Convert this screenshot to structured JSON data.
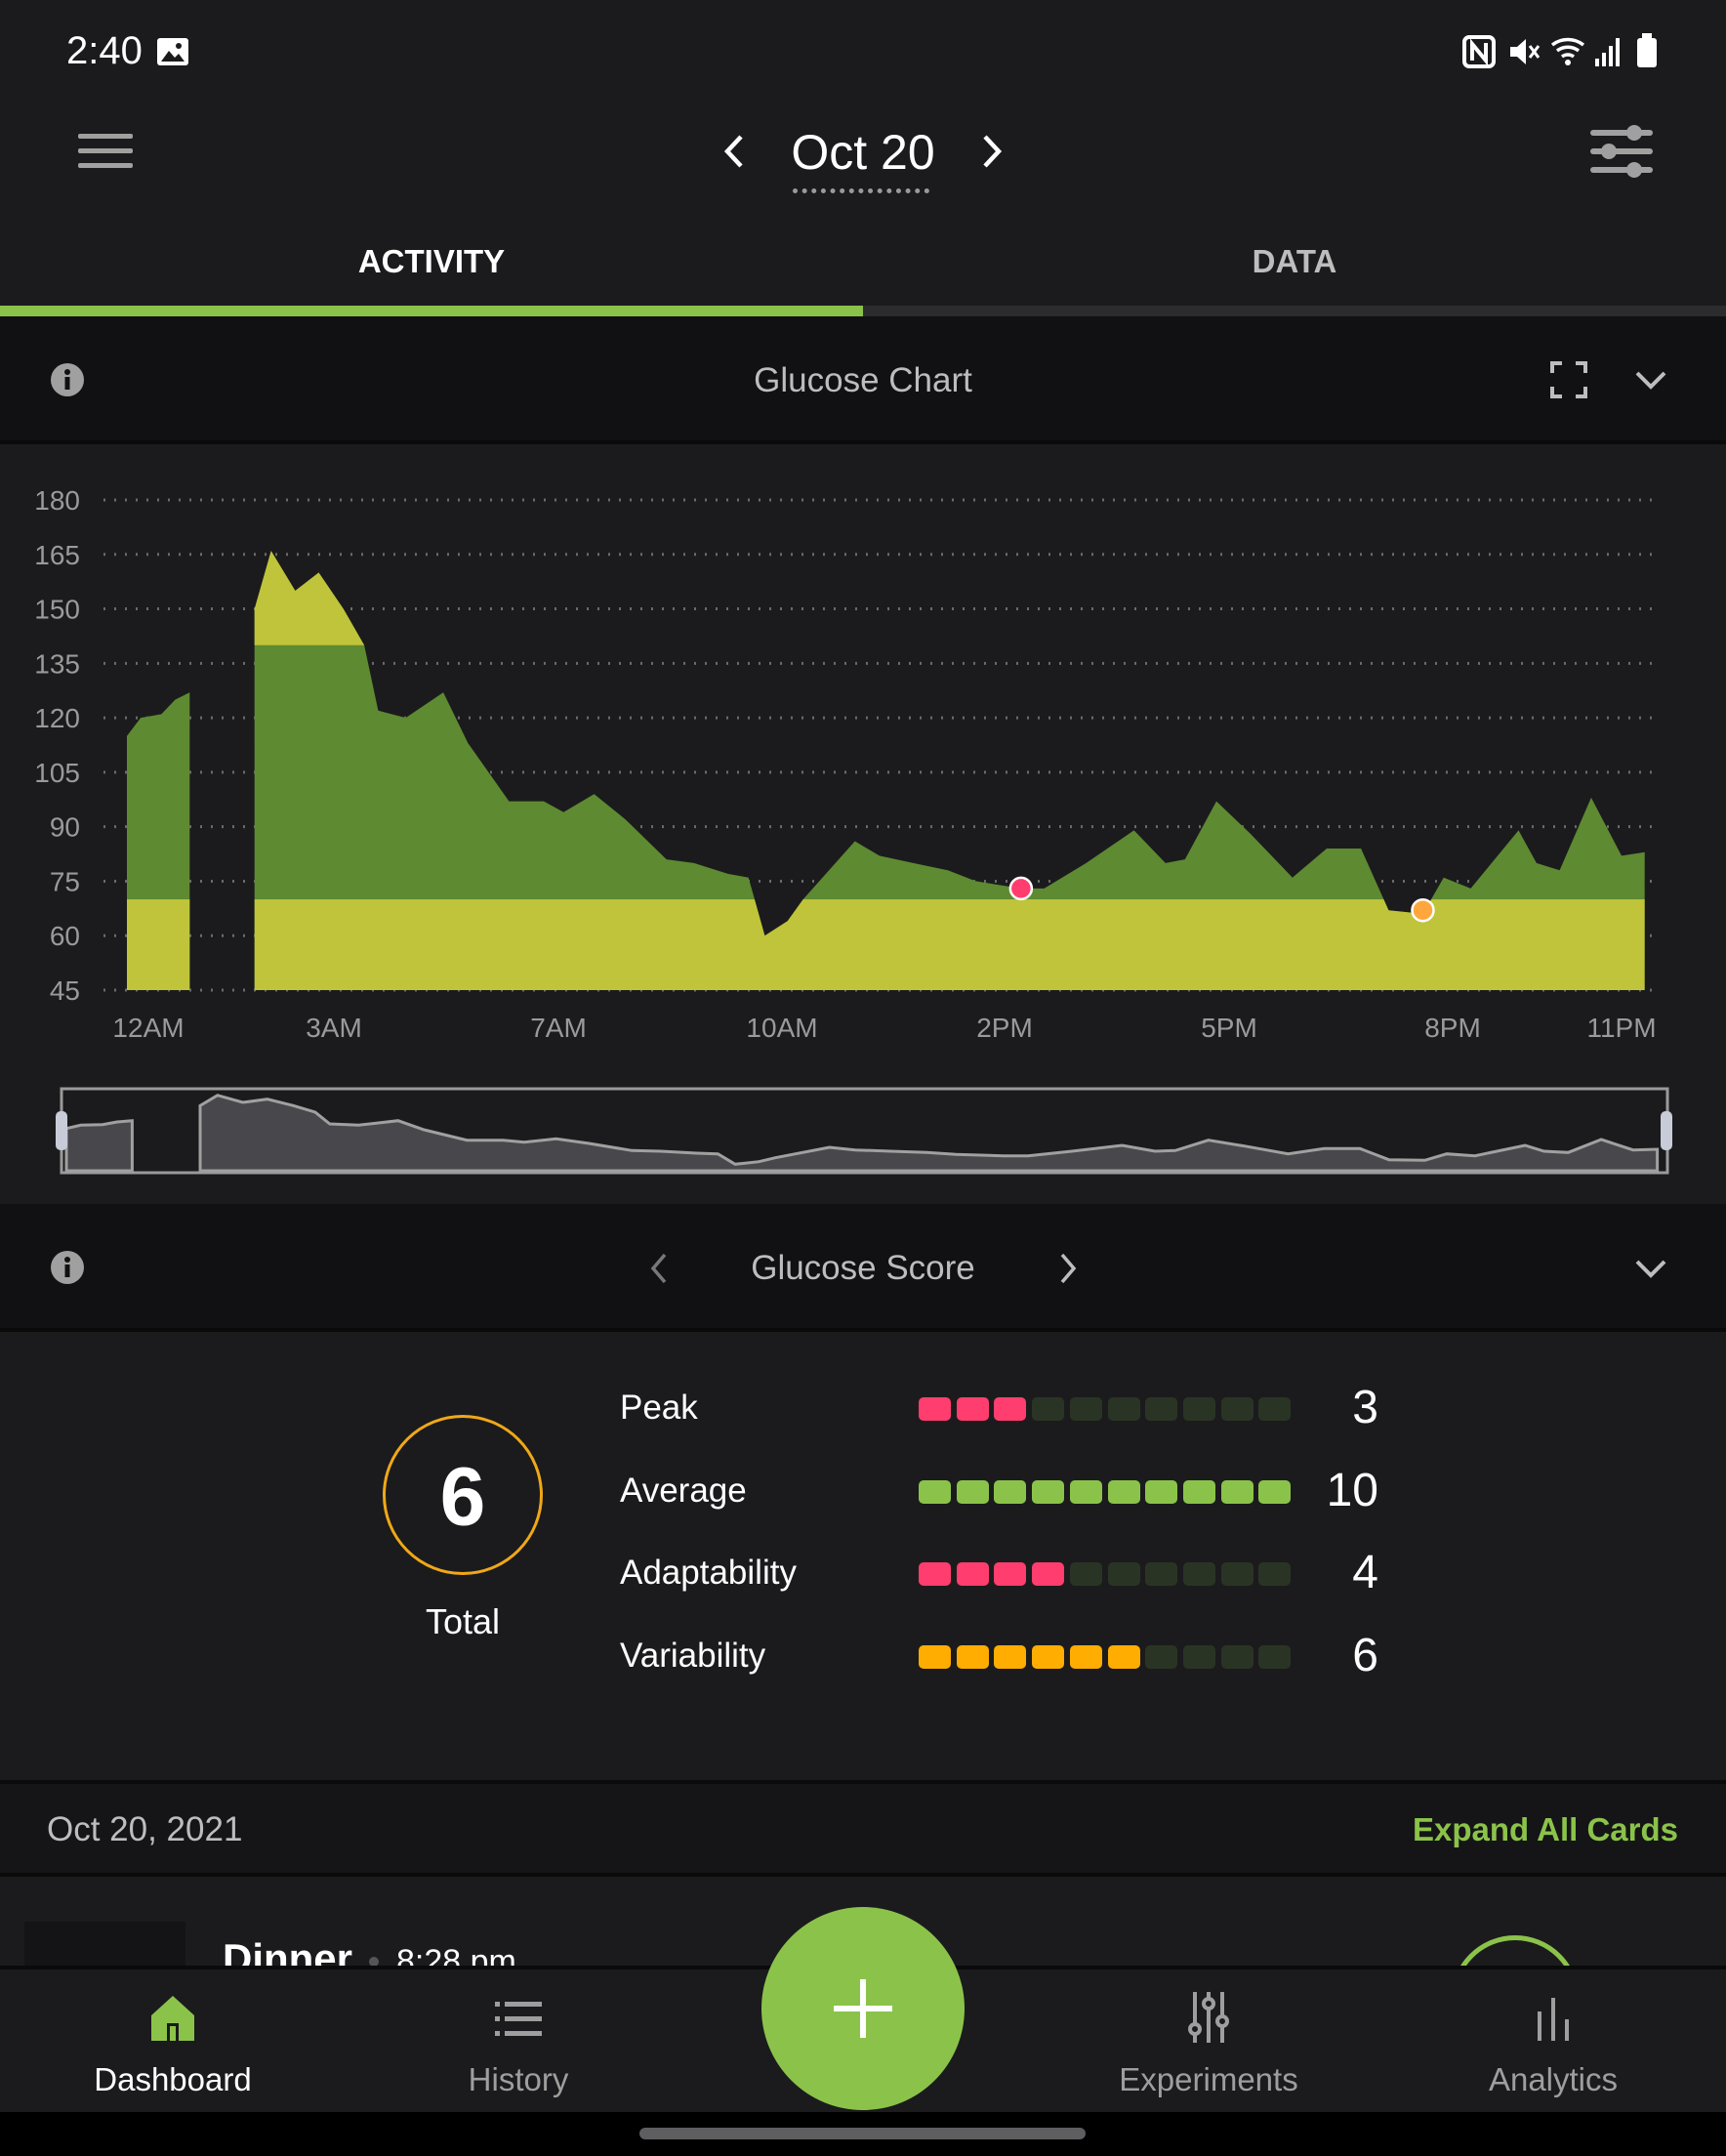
{
  "status_bar": {
    "time": "2:40",
    "icons": [
      "image-icon",
      "nfc-icon",
      "mute-icon",
      "wifi-icon",
      "signal-icon",
      "battery-icon"
    ]
  },
  "header": {
    "date": "Oct 20",
    "menu_icon": "hamburger-icon",
    "filter_icon": "sliders-icon"
  },
  "tabs": [
    {
      "label": "ACTIVITY",
      "active": true
    },
    {
      "label": "DATA",
      "active": false
    }
  ],
  "colors": {
    "accent": "#8bc34a",
    "in_range": "#5e8a31",
    "out_range": "#bfc43a",
    "peak": "#ff3d6e",
    "average": "#8bc34a",
    "variability": "#ffad00",
    "empty": "#2a3424",
    "ring": "#f0a818"
  },
  "glucose_chart": {
    "title": "Glucose Chart"
  },
  "chart_data": {
    "type": "area",
    "title": "Glucose Chart",
    "ylim": [
      45,
      180
    ],
    "y_ticks": [
      180,
      165,
      150,
      135,
      120,
      105,
      90,
      75,
      60,
      45
    ],
    "x_ticks": [
      "12AM",
      "3AM",
      "7AM",
      "10AM",
      "2PM",
      "5PM",
      "8PM",
      "11PM"
    ],
    "x_units": "hours since midnight",
    "target_range": [
      70,
      140
    ],
    "grid": true,
    "segments": [
      [
        [
          0,
          115
        ],
        [
          0.2,
          120
        ],
        [
          0.5,
          121
        ],
        [
          0.7,
          125
        ],
        [
          0.91,
          127
        ]
      ],
      [
        [
          1.85,
          150
        ],
        [
          2.09,
          166
        ],
        [
          2.44,
          155
        ],
        [
          2.78,
          160
        ],
        [
          3.17,
          150
        ],
        [
          3.54,
          140
        ],
        [
          3.79,
          122
        ],
        [
          4.28,
          120
        ],
        [
          4.95,
          127
        ],
        [
          5.39,
          113
        ],
        [
          6.12,
          97
        ],
        [
          6.74,
          97
        ],
        [
          7.07,
          94
        ],
        [
          7.48,
          99
        ],
        [
          7.9,
          92
        ],
        [
          8.45,
          81
        ],
        [
          8.82,
          80
        ],
        [
          9.28,
          77
        ],
        [
          9.55,
          76
        ],
        [
          9.77,
          60
        ],
        [
          10.1,
          64
        ],
        [
          10.38,
          70
        ],
        [
          11.31,
          86
        ],
        [
          11.75,
          82
        ],
        [
          12.36,
          80
        ],
        [
          12.98,
          78
        ],
        [
          13.48,
          75
        ],
        [
          14.22,
          73
        ],
        [
          14.53,
          73
        ],
        [
          15.09,
          80
        ],
        [
          15.73,
          89
        ],
        [
          16.15,
          80
        ],
        [
          16.41,
          81
        ],
        [
          16.83,
          97
        ],
        [
          17.29,
          88
        ],
        [
          17.85,
          76
        ],
        [
          18.31,
          84
        ],
        [
          18.77,
          84
        ],
        [
          19.14,
          67
        ],
        [
          19.6,
          66
        ],
        [
          19.88,
          76
        ],
        [
          20.32,
          73
        ],
        [
          21.17,
          89
        ],
        [
          21.49,
          80
        ],
        [
          21.9,
          78
        ],
        [
          22.46,
          98
        ],
        [
          23,
          82
        ],
        [
          23.41,
          83
        ]
      ]
    ],
    "markers": [
      {
        "x": 14.22,
        "y": 73,
        "color": "#ff3d6e"
      },
      {
        "x": 19.6,
        "y": 67,
        "color": "#ffa63d"
      }
    ]
  },
  "glucose_score": {
    "title": "Glucose Score",
    "total": "6",
    "total_label": "Total",
    "rows": [
      {
        "label": "Peak",
        "value": "3",
        "filled": 3,
        "color": "#ff3d6e"
      },
      {
        "label": "Average",
        "value": "10",
        "filled": 10,
        "color": "#8bc34a"
      },
      {
        "label": "Adaptability",
        "value": "4",
        "filled": 4,
        "color": "#ff3d6e"
      },
      {
        "label": "Variability",
        "value": "6",
        "filled": 6,
        "color": "#ffad00"
      }
    ],
    "max": 10
  },
  "day": {
    "date": "Oct 20, 2021",
    "expand_label": "Expand All Cards"
  },
  "card": {
    "title": "Dinner",
    "time": "8:28 pm"
  },
  "bottom_nav": [
    {
      "label": "Dashboard",
      "icon": "home-icon",
      "active": true
    },
    {
      "label": "History",
      "icon": "list-icon",
      "active": false
    },
    {
      "label": "Experiments",
      "icon": "experiments-icon",
      "active": false
    },
    {
      "label": "Analytics",
      "icon": "bar-chart-icon",
      "active": false
    }
  ],
  "fab": {
    "icon": "plus-icon"
  }
}
